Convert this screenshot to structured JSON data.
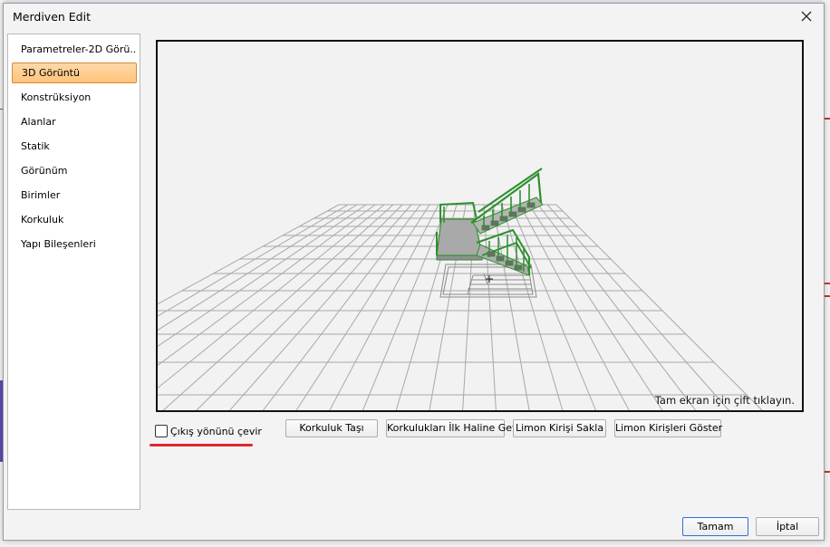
{
  "window": {
    "title": "Merdiven Edit"
  },
  "sidebar": {
    "items": [
      {
        "label": "Parametreler-2D Görü..."
      },
      {
        "label": "3D Görüntü",
        "active": true
      },
      {
        "label": "Konstrüksiyon"
      },
      {
        "label": "Alanlar"
      },
      {
        "label": "Statik"
      },
      {
        "label": "Görünüm"
      },
      {
        "label": "Birimler"
      },
      {
        "label": "Korkuluk"
      },
      {
        "label": "Yapı Bileşenleri"
      }
    ]
  },
  "viewport": {
    "hint": "Tam ekran için çift tıklayın."
  },
  "controls": {
    "flip_checkbox_label": "Çıkış yönünü çevir",
    "flip_checked": false,
    "buttons": [
      {
        "label": "Korkuluk Taşı"
      },
      {
        "label": "Korkulukları İlk Haline Getir"
      },
      {
        "label": "Limon Kirişi Sakla"
      },
      {
        "label": "Limon Kirişleri Göster"
      }
    ]
  },
  "footer": {
    "ok_label": "Tamam",
    "cancel_label": "İptal"
  },
  "colors": {
    "active_item": "#ffc47a",
    "stair_green": "#2f8f2f",
    "annotation_red": "#e0282e",
    "primary_border": "#2e6fd8"
  }
}
